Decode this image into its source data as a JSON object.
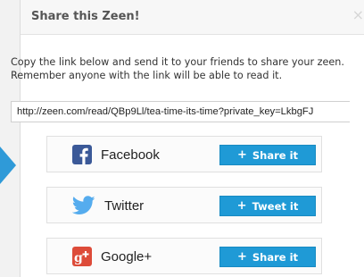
{
  "dialog": {
    "title": "Share this Zeen!",
    "close_glyph": "×",
    "instructions": [
      "Copy the link below and send it to your friends to share your zeen.",
      "Remember anyone with the link will be able to read it."
    ],
    "share_link": "http://zeen.com/read/QBp9Ll/tea-time-its-time?private_key=LkbgFJ"
  },
  "networks": [
    {
      "name": "Facebook",
      "icon": "facebook-icon",
      "button_icon": "plus-icon",
      "button_label": "Share it"
    },
    {
      "name": "Twitter",
      "icon": "twitter-icon",
      "button_icon": "plus-icon",
      "button_label": "Tweet it"
    },
    {
      "name": "Google+",
      "icon": "google-plus-icon",
      "button_icon": "plus-icon",
      "button_label": "Share it"
    }
  ],
  "colors": {
    "button_blue": "#1f9ad6",
    "pointer_blue": "#2f9ad8",
    "facebook_blue": "#3b5998",
    "twitter_blue": "#55acee",
    "google_red": "#dd4b39"
  }
}
